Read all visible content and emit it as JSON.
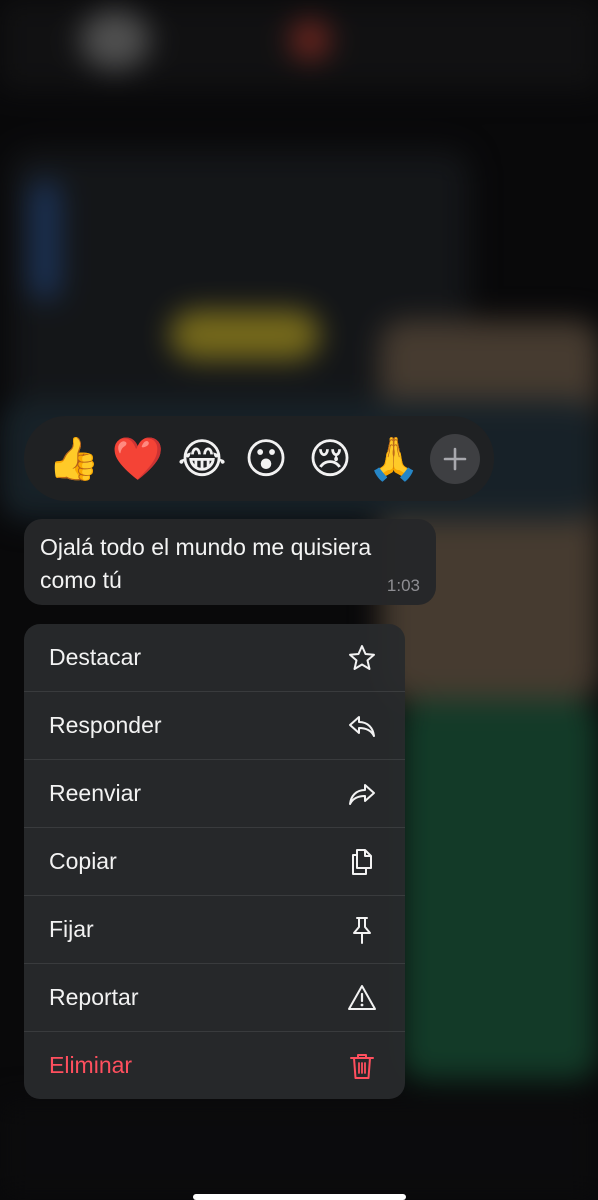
{
  "reactions": {
    "emojis": [
      {
        "name": "thumbs-up",
        "glyph": "👍"
      },
      {
        "name": "red-heart",
        "glyph": "❤️"
      },
      {
        "name": "face-with-tears-of-joy",
        "glyph": "😂"
      },
      {
        "name": "face-with-open-mouth",
        "glyph": "😮"
      },
      {
        "name": "crying-face",
        "glyph": "😢"
      },
      {
        "name": "folded-hands",
        "glyph": "🙏"
      }
    ],
    "more_icon": "plus-icon"
  },
  "message": {
    "text": "Ojalá todo el mundo me quisiera como tú",
    "time": "1:03"
  },
  "menu": {
    "items": [
      {
        "label": "Destacar",
        "icon": "star-icon"
      },
      {
        "label": "Responder",
        "icon": "reply-icon"
      },
      {
        "label": "Reenviar",
        "icon": "forward-icon"
      },
      {
        "label": "Copiar",
        "icon": "copy-icon"
      },
      {
        "label": "Fijar",
        "icon": "pin-icon"
      },
      {
        "label": "Reportar",
        "icon": "warning-icon"
      },
      {
        "label": "Eliminar",
        "icon": "trash-icon"
      }
    ]
  },
  "colors": {
    "danger": "#ff4f5e",
    "menu_bg": "#282a2c",
    "bubble_bg": "#262729"
  }
}
